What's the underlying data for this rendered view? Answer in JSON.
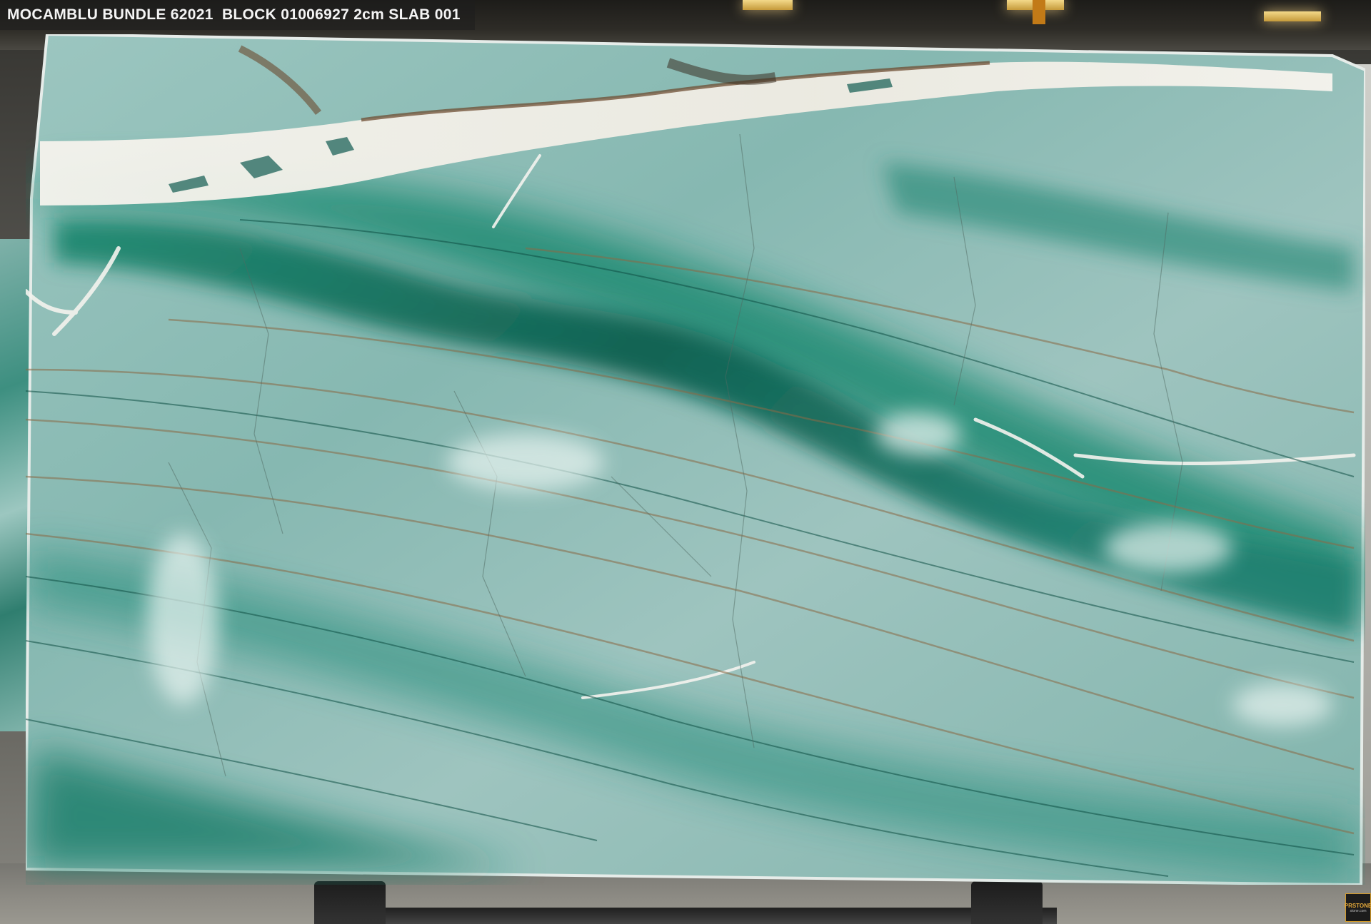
{
  "caption": {
    "text": "MOCAMBLU BUNDLE 62021  BLOCK 01006927 2cm SLAB 001"
  },
  "slab": {
    "material": "quartzite",
    "base_color": "#8fbdb6",
    "vein_green": "#1d7a66",
    "vein_dark": "#0f4f44",
    "vein_white": "#f2f0ea",
    "vein_brown": "#7a5a3a"
  },
  "watermark": {
    "brand_icon": "stone-logo-icon",
    "mark": "PRSTONE",
    "sub": "stone.com"
  }
}
